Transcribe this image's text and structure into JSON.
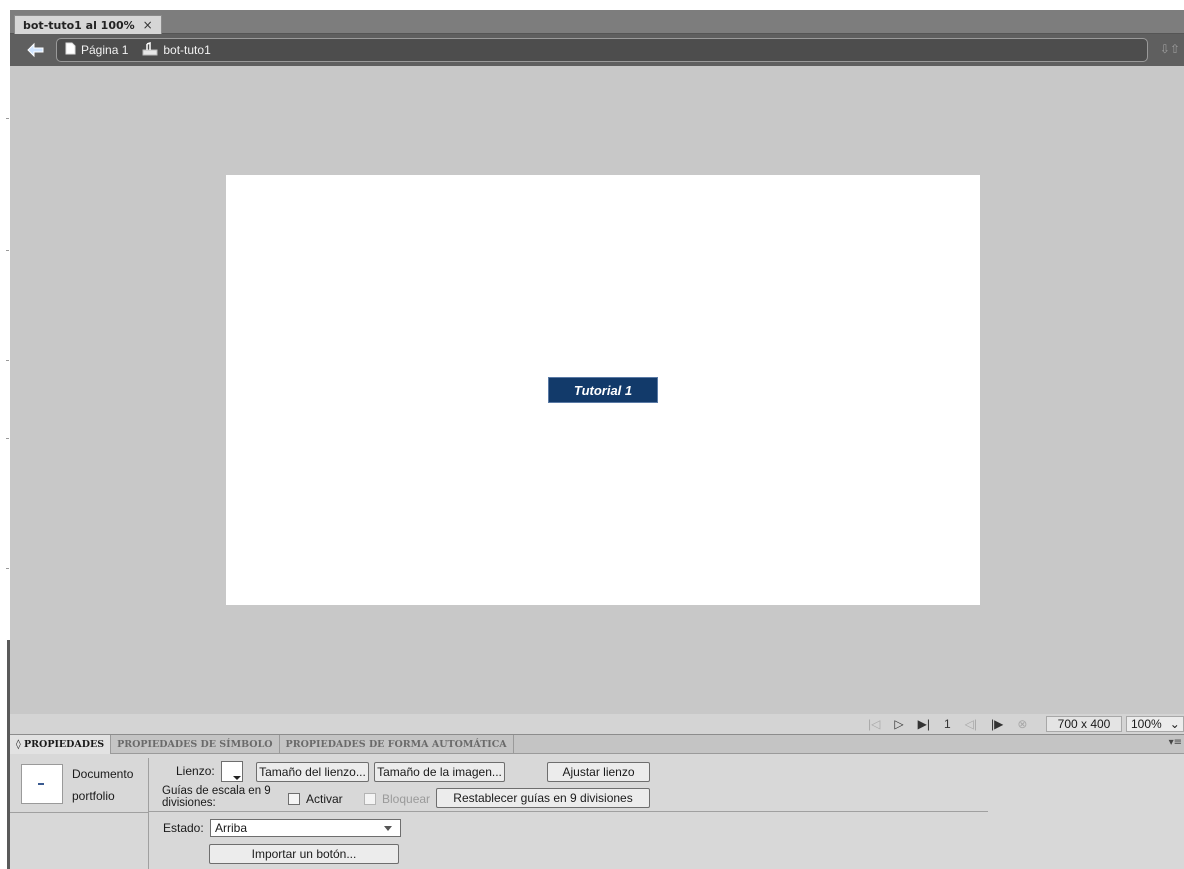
{
  "document_tab": {
    "title": "bot-tuto1 al 100%",
    "close_glyph": "×"
  },
  "breadcrumb": {
    "items": [
      {
        "icon": "page-icon",
        "label": "Página 1"
      },
      {
        "icon": "button-symbol-icon",
        "label": "bot-tuto1"
      }
    ]
  },
  "stage": {
    "button_label": "Tutorial 1",
    "button_color": "#123a6a"
  },
  "statusbar": {
    "frame": "1",
    "canvas_size": "700 x 400",
    "zoom": "100%"
  },
  "properties_panel": {
    "tabs": [
      {
        "label": "◊ PROPIEDADES",
        "active": true
      },
      {
        "label": "PROPIEDADES DE SÍMBOLO",
        "active": false
      },
      {
        "label": "PROPIEDADES DE FORMA AUTOMÁTICA",
        "active": false
      }
    ],
    "doc_type": "Documento",
    "doc_name": "portfolio",
    "canvas_label": "Lienzo:",
    "canvas_size_button": "Tamaño del lienzo...",
    "image_size_button": "Tamaño de la imagen...",
    "fit_canvas_button": "Ajustar lienzo",
    "nine_slice_label": "Guías de escala en 9 divisiones:",
    "enable_label": "Activar",
    "lock_label": "Bloquear",
    "reset_guides_button": "Restablecer guías en 9 divisiones",
    "state_label": "Estado:",
    "state_value": "Arriba",
    "import_button": "Importar un botón..."
  }
}
